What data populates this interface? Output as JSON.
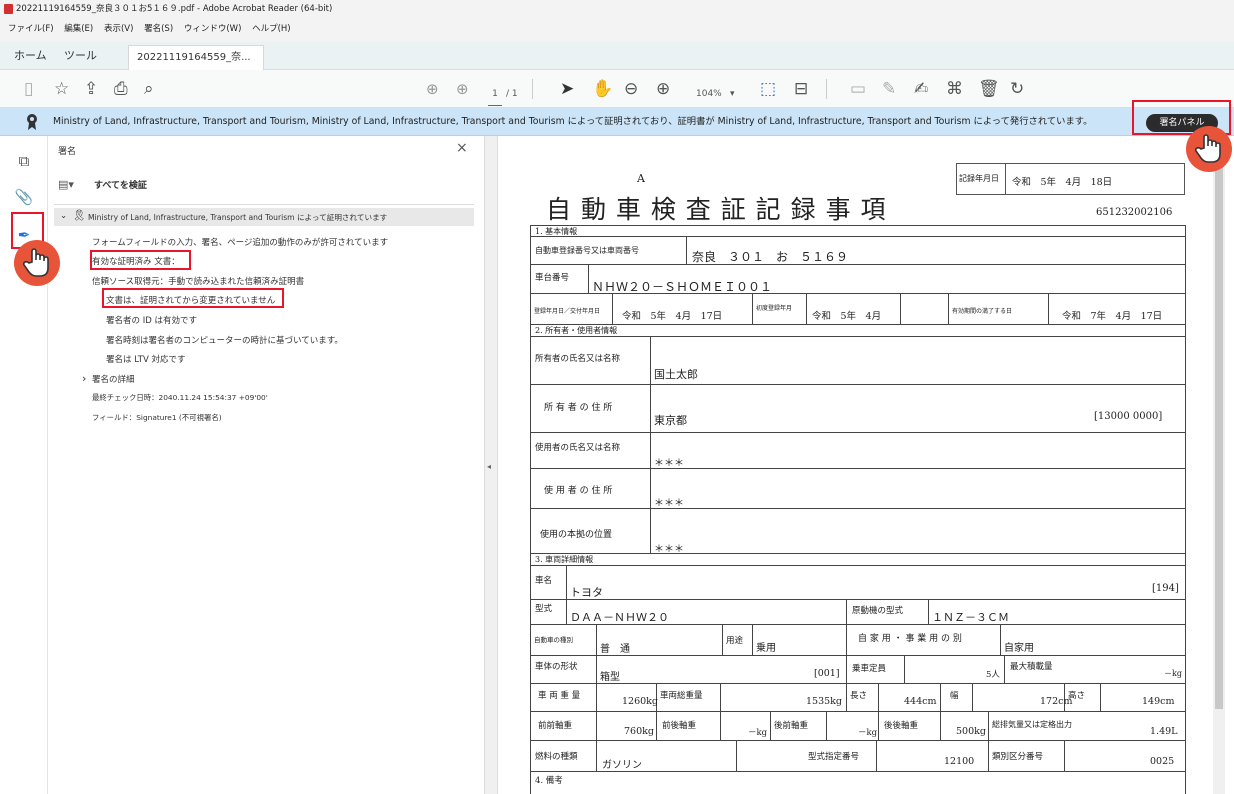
{
  "window": {
    "title": "20221119164559_奈良３０１お5１６９.pdf - Adobe Acrobat Reader (64-bit)"
  },
  "menu": [
    "ファイル(F)",
    "編集(E)",
    "表示(V)",
    "署名(S)",
    "ウィンドウ(W)",
    "ヘルプ(H)"
  ],
  "tabs": {
    "home": "ホーム",
    "tools": "ツール",
    "doc": "20221119164559_奈...",
    "close": "×"
  },
  "toolbar": {
    "page_current": "1",
    "page_total": "/ 1",
    "zoom": "104%"
  },
  "cert": {
    "message": "Ministry of Land, Infrastructure, Transport and Tourism, Ministry of Land, Infrastructure, Transport and Tourism によって証明されており、証明書が Ministry of Land, Infrastructure, Transport and Tourism によって発行されています。",
    "button": "署名パネル"
  },
  "panel": {
    "title": "署名",
    "close": "×",
    "verify_all": "すべてを検証",
    "signer": "Ministry of Land, Infrastructure, Transport and Tourism によって証明されています",
    "items": [
      "フォームフィールドの入力、署名、ページ追加の動作のみが許可されています",
      "有効な証明済み 文書：",
      "信頼ソース取得元：手動で読み込まれた信頼済み証明書",
      "文書は、証明されてから変更されていません",
      "署名者の ID は有効です",
      "署名時刻は署名者のコンピューターの時計に基づいています。",
      "署名は LTV 対応です"
    ],
    "details": "署名の詳細",
    "last_check": "最終チェック日時：2040.11.24 15:54:37 +09'00'",
    "field": "フィールド：Signature1 (不可視署名)"
  },
  "doc": {
    "rec_date_label": "記録年月日",
    "rec_date": "令和　5年　4月　18日",
    "letter": "A",
    "title": "自 動 車 検 査 証 記 録 事 項",
    "number": "651232002106",
    "sec1": "1. 基本情報",
    "reg_label": "自動車登録番号又は車両番号",
    "reg": "奈良　３０１　お　５１６９",
    "chassis_label": "車台番号",
    "chassis": "ＮＨＷ２０－ＳＨＯＭＥＩ００１",
    "regdate_label": "登録年月日／交付年月日",
    "regdate": "令和　5年　4月　17日",
    "first_label": "初度登録年月",
    "first": "令和　5年　4月",
    "expiry_label": "有効期間の満了する日",
    "expiry": "令和　7年　4月　17日",
    "sec2": "2. 所有者・使用者情報",
    "owner_name_label": "所有者の氏名又は名称",
    "owner_name": "国土太郎",
    "owner_addr_label": "所 有 者 の 住 所",
    "owner_addr": "東京都",
    "owner_code": "[13000 0000]",
    "user_name_label": "使用者の氏名又は名称",
    "user_name": "＊＊＊",
    "user_addr_label": "使 用 者 の 住 所",
    "user_addr": "＊＊＊",
    "base_label": "使用の本拠の位置",
    "base": "＊＊＊",
    "sec3": "3. 車両詳細情報",
    "maker_label": "車名",
    "maker": "トヨタ",
    "maker_code": "[194]",
    "model_label": "型式",
    "model": "ＤＡＡ－ＮＨＷ２０",
    "engine_label": "原動機の型式",
    "engine": "１ＮＺ－３ＣＭ",
    "kind_label": "自動車の種別",
    "kind": "普　通",
    "use_label": "用途",
    "use": "乗用",
    "biz_label": "自 家 用 ・ 事 業 用 の 別",
    "biz": "自家用",
    "body_label": "車体の形状",
    "body": "箱型",
    "body_code": "[001]",
    "cap_label": "乗車定員",
    "cap": "5人",
    "load_label": "最大積載量",
    "load": "－kg",
    "weight_label": "車 両 重 量",
    "weight": "1260kg",
    "gross_label": "車両総重量",
    "gross": "1535kg",
    "len_label": "長さ",
    "len": "444cm",
    "wid_label": "幅",
    "wid": "172cm",
    "hgt_label": "高さ",
    "hgt": "149cm",
    "ff_label": "前前軸重",
    "ff": "760kg",
    "fr_label": "前後軸重",
    "fr": "－kg",
    "rf_label": "後前軸重",
    "rf": "－kg",
    "rr_label": "後後軸重",
    "rr": "500kg",
    "disp_label": "総排気量又は定格出力",
    "disp": "1.49L",
    "fuel_label": "燃料の種類",
    "fuel": "ガソリン",
    "type_no_label": "型式指定番号",
    "type_no": "12100",
    "cat_label": "類別区分番号",
    "cat": "0025",
    "sec4": "4. 備考"
  }
}
